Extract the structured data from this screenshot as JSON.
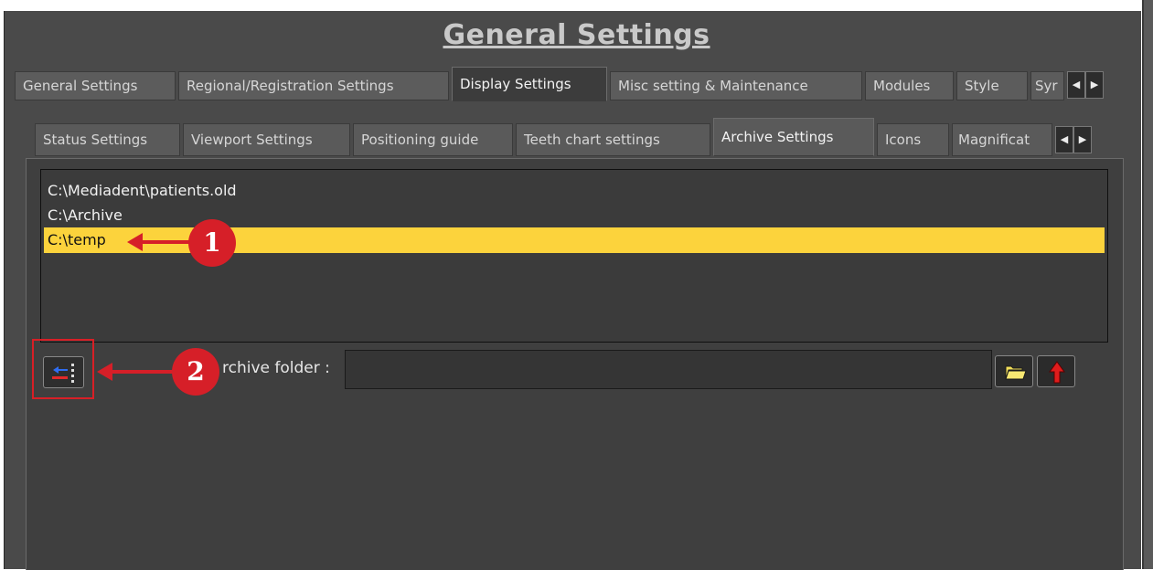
{
  "title": "General Settings",
  "main_tabs": [
    {
      "label": "General Settings"
    },
    {
      "label": "Regional/Registration Settings"
    },
    {
      "label": "Display Settings",
      "active": true
    },
    {
      "label": "Misc setting & Maintenance"
    },
    {
      "label": "Modules"
    },
    {
      "label": "Style"
    },
    {
      "label": "Syr"
    }
  ],
  "sub_tabs": [
    {
      "label": "Status Settings"
    },
    {
      "label": "Viewport Settings"
    },
    {
      "label": "Positioning guide"
    },
    {
      "label": "Teeth chart settings"
    },
    {
      "label": "Archive Settings",
      "active": true
    },
    {
      "label": "Icons"
    },
    {
      "label": "Magnificat"
    }
  ],
  "archive_folders": [
    {
      "path": "C:\\Mediadent\\patients.old"
    },
    {
      "path": "C:\\Archive"
    },
    {
      "path": "C:\\temp",
      "selected": true
    }
  ],
  "archive_folder_label": "rchive folder :",
  "archive_folder_value": "",
  "icons": {
    "add_button": "add-to-list-icon",
    "browse_button": "folder-open-icon",
    "remove_button": "red-arrow-up-icon",
    "tab_scroll_left": "triangle-left-icon",
    "tab_scroll_right": "triangle-right-icon"
  },
  "annotations": [
    {
      "number": "1"
    },
    {
      "number": "2"
    }
  ],
  "colors": {
    "background": "#4a4a4a",
    "selected_row": "#fcd33c",
    "annotation_red": "#d61f28"
  }
}
